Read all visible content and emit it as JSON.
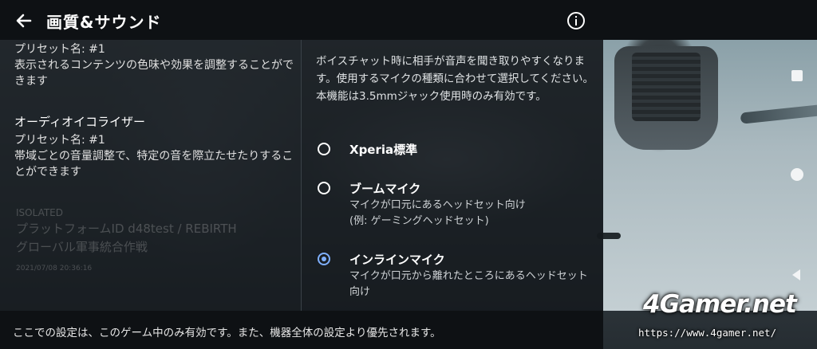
{
  "header": {
    "title": "画質&サウンド",
    "back_icon": "arrow-left-icon",
    "info_icon": "info-circle-icon"
  },
  "left_panel": {
    "item_top": {
      "preset": "プリセット名: #1",
      "description": "表示されるコンテンツの色味や効果を調整することができます"
    },
    "equalizer": {
      "name": "オーディオイコライザー",
      "preset": "プリセット名: #1",
      "description": "帯域ごとの音量調整で、特定の音を際立たせたりすることができます"
    },
    "watermark": {
      "line1": "ISOLATED",
      "line2": "プラットフォームID d48test / REBIRTH",
      "line3": "グローバル軍事統合作戦",
      "line4": "2021/07/08 20:36:16"
    }
  },
  "right_panel": {
    "description": "ボイスチャット時に相手が音声を聞き取りやすくなります。使用するマイクの種類に合わせて選択してください。本機能は3.5mmジャック使用時のみ有効です。",
    "options": [
      {
        "label": "Xperia標準",
        "sub": "",
        "checked": false
      },
      {
        "label": "ブームマイク",
        "sub": "マイクが口元にあるヘッドセット向け\n(例: ゲーミングヘッドセット)",
        "checked": false
      },
      {
        "label": "インラインマイク",
        "sub": "マイクが口元から離れたところにあるヘッドセット向け",
        "checked": true
      }
    ]
  },
  "footer": {
    "text": "ここでの設定は、このゲーム中のみ有効です。また、機器全体の設定より優先されます。"
  },
  "nav": {
    "recents_icon": "square-icon",
    "home_icon": "circle-icon",
    "back_icon": "triangle-back-icon"
  },
  "logo": {
    "main": "4Gamer.net",
    "url": "https://www.4gamer.net/"
  },
  "colors": {
    "accent": "#7fb0ff",
    "header_bg": "#0e1114"
  }
}
